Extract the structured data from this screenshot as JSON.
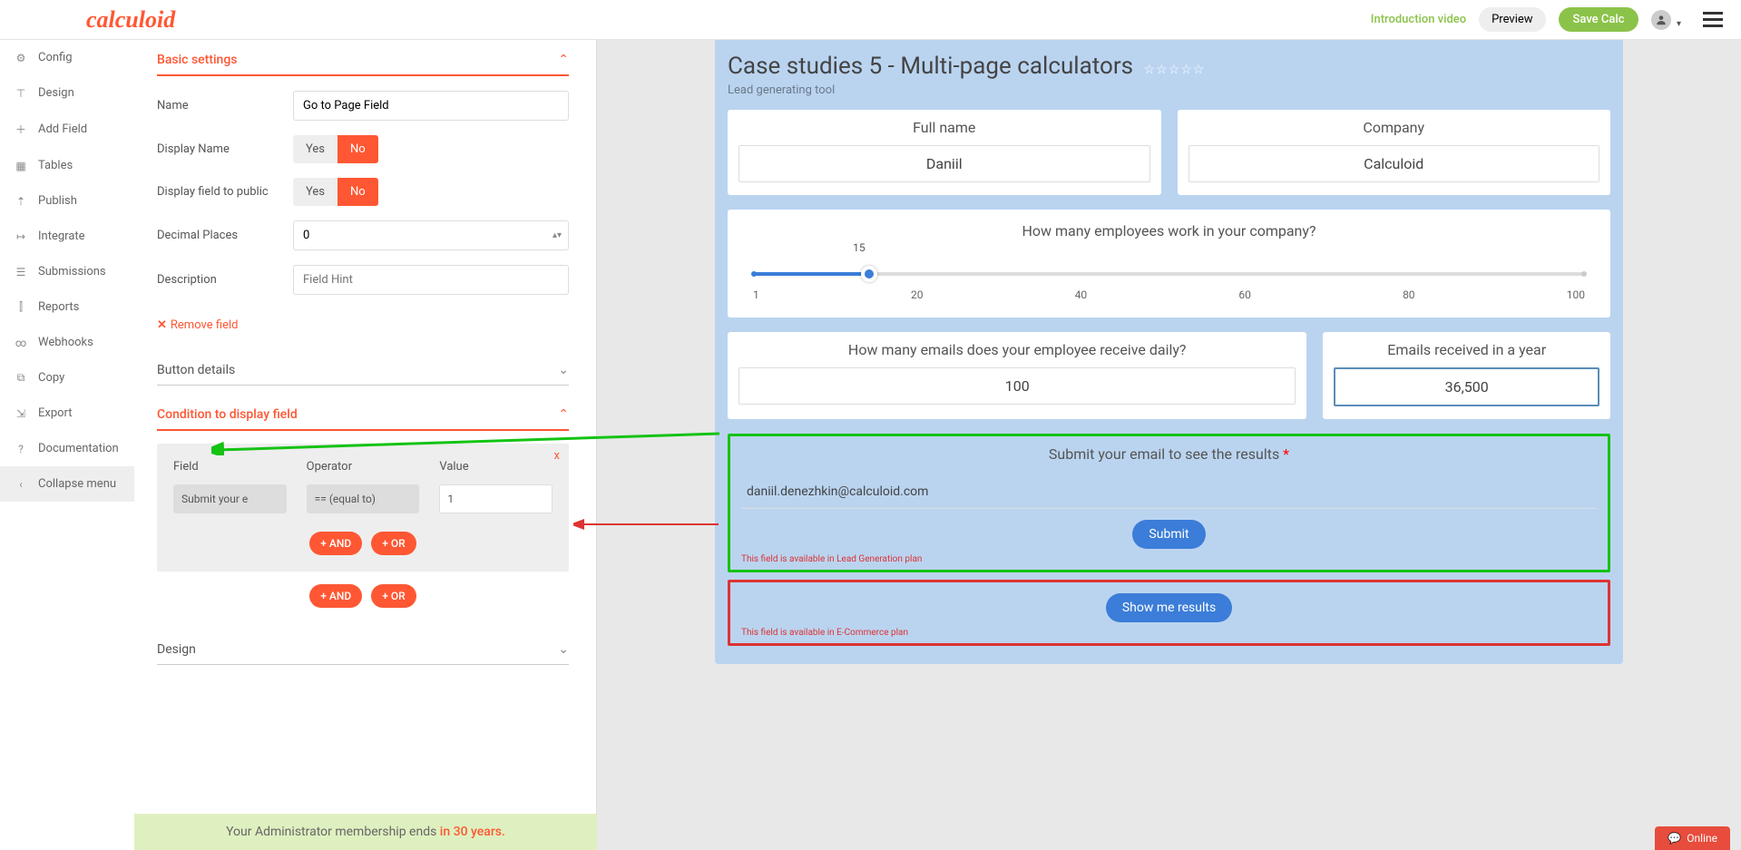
{
  "topbar": {
    "logo": "calculoid",
    "intro": "Introduction video",
    "preview": "Preview",
    "save": "Save Calc"
  },
  "sidebar": {
    "items": [
      {
        "icon": "⚙",
        "label": "Config"
      },
      {
        "icon": "⊤",
        "label": "Design"
      },
      {
        "icon": "＋",
        "label": "Add Field"
      },
      {
        "icon": "▦",
        "label": "Tables"
      },
      {
        "icon": "⇡",
        "label": "Publish"
      },
      {
        "icon": "↦",
        "label": "Integrate"
      },
      {
        "icon": "☰",
        "label": "Submissions"
      },
      {
        "icon": "⫿",
        "label": "Reports"
      },
      {
        "icon": "∞",
        "label": "Webhooks"
      },
      {
        "icon": "⧉",
        "label": "Copy"
      },
      {
        "icon": "⇲",
        "label": "Export"
      },
      {
        "icon": "?",
        "label": "Documentation"
      },
      {
        "icon": "‹",
        "label": "Collapse menu"
      }
    ]
  },
  "editor": {
    "basic": {
      "title": "Basic settings",
      "name_label": "Name",
      "name_value": "Go to Page Field",
      "display_name_label": "Display Name",
      "display_public_label": "Display field to public",
      "yes": "Yes",
      "no": "No",
      "decimal_label": "Decimal Places",
      "decimal_value": "0",
      "desc_label": "Description",
      "desc_placeholder": "Field Hint",
      "remove": "Remove field"
    },
    "button_details": "Button details",
    "condition": {
      "title": "Condition to display field",
      "close": "x",
      "field": "Field",
      "operator": "Operator",
      "value": "Value",
      "field_val": "Submit your e",
      "op_val": "== (equal to)",
      "val_val": "1",
      "and": "+ AND",
      "or": "+ OR"
    },
    "design": "Design"
  },
  "calc": {
    "title": "Case studies 5 - Multi-page calculators",
    "subtitle": "Lead generating tool",
    "fullname_label": "Full name",
    "fullname_value": "Daniil",
    "company_label": "Company",
    "company_value": "Calculoid",
    "slider_q": "How many employees work in your company?",
    "slider_val": "15",
    "ticks": [
      "1",
      "20",
      "40",
      "60",
      "80",
      "100"
    ],
    "emails_q": "How many emails does your employee receive daily?",
    "emails_val": "100",
    "year_label": "Emails received in a year",
    "year_val": "36,500",
    "submit_title": "Submit your email to see the results",
    "email_value": "daniil.denezhkin@calculoid.com",
    "submit_btn": "Submit",
    "plan_lead": "This field is available in Lead Generation plan",
    "show_results": "Show me results",
    "plan_ecom": "This field is available in E-Commerce plan"
  },
  "footer": {
    "text": "Your Administrator membership ends ",
    "hl": "in 30 years."
  },
  "online": "Online"
}
